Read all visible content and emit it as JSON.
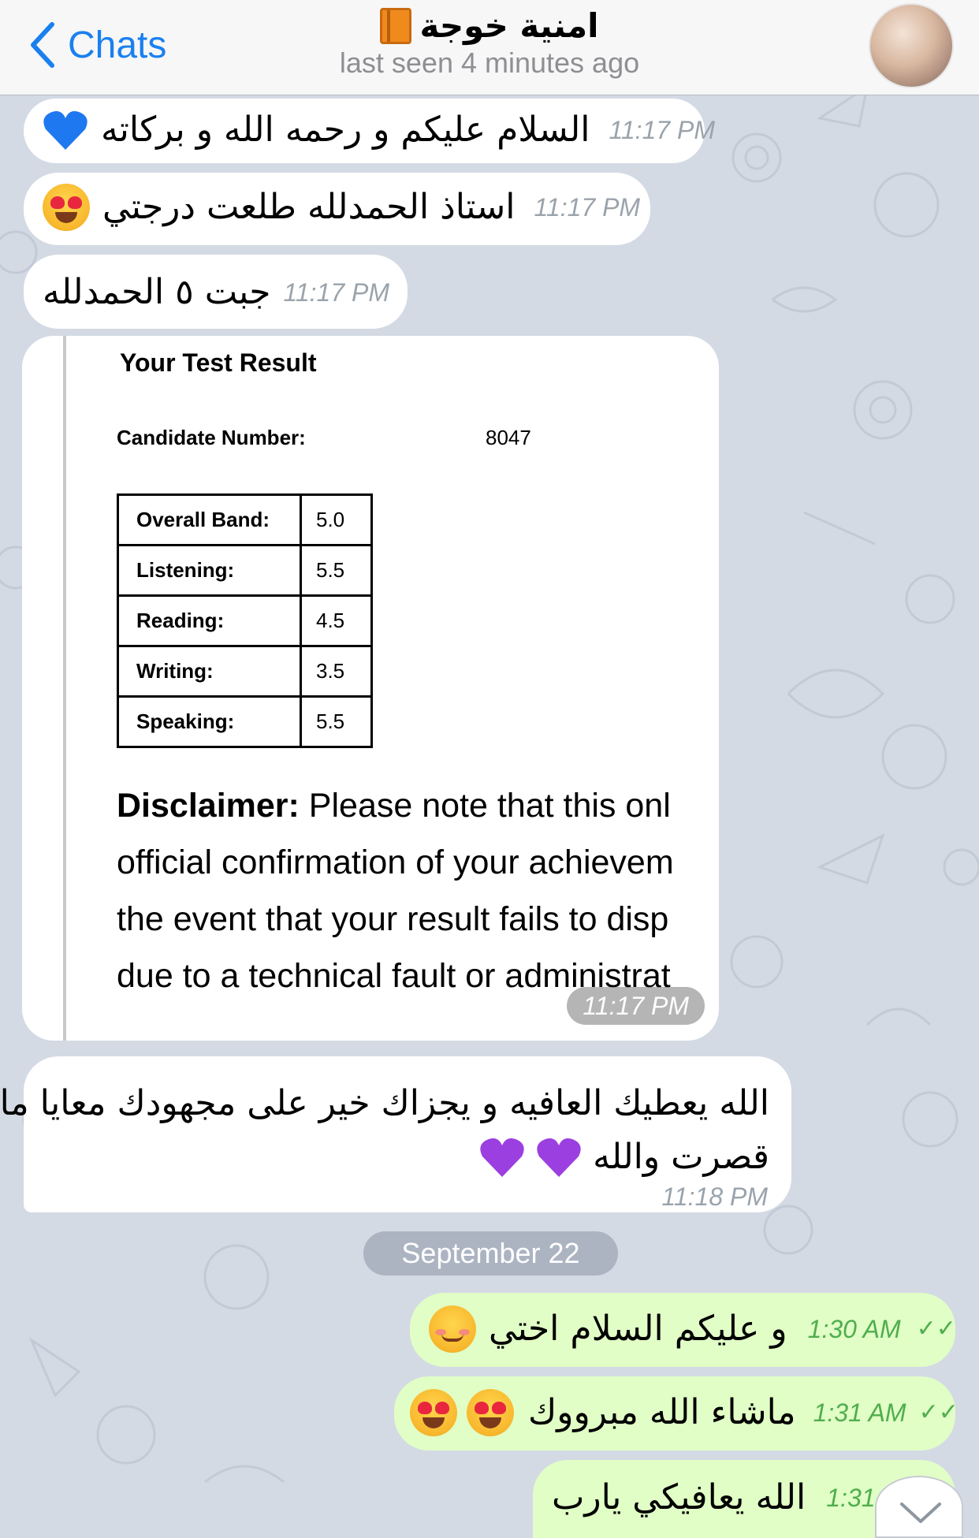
{
  "header": {
    "back_label": "Chats",
    "contact_name": "امنية خوجة",
    "status": "last seen 4 minutes ago"
  },
  "messages": [
    {
      "text": "السلام عليكم و رحمه الله و بركاته",
      "time": "11:17 PM",
      "emoji": [
        "blue-heart"
      ]
    },
    {
      "text": "استاذ الحمدلله طلعت درجتي",
      "time": "11:17 PM",
      "emoji": [
        "heart-eyes"
      ]
    },
    {
      "text": "جبت ٥ الحمدلله",
      "time": "11:17 PM"
    },
    {
      "text_line1": "الله يعطيك العافيه و يجزاك خير على مجهودك معايا ما",
      "text_line2": "قصرت والله",
      "time": "11:18 PM",
      "emoji": [
        "purple-heart",
        "purple-heart"
      ]
    }
  ],
  "photo": {
    "title": "Your Test Result",
    "candidate_label": "Candidate Number:",
    "candidate_number": "8047",
    "bands": [
      {
        "label": "Overall Band:",
        "score": "5.0"
      },
      {
        "label": "Listening:",
        "score": "5.5"
      },
      {
        "label": "Reading:",
        "score": "4.5"
      },
      {
        "label": "Writing:",
        "score": "3.5"
      },
      {
        "label": "Speaking:",
        "score": "5.5"
      }
    ],
    "disclaimer_bold": "Disclaimer:",
    "disclaimer_line1": " Please note that this onl",
    "disclaimer_line2": "official confirmation of your achievem",
    "disclaimer_line3": "the event that your result fails to disp",
    "disclaimer_line4": "due to a technical fault or administrat",
    "time": "11:17 PM"
  },
  "date_separator": "September 22",
  "outgoing": [
    {
      "text": "و عليكم السلام اختي",
      "time": "1:30 AM",
      "emoji": [
        "smiling-face"
      ]
    },
    {
      "text": "ماشاء الله مبرووك",
      "time": "1:31 AM",
      "emoji": [
        "heart-eyes",
        "heart-eyes"
      ]
    },
    {
      "text": "الله يعافيكي يارب",
      "time": "1:31 A"
    }
  ],
  "colors": {
    "accent": "#1a80f0",
    "outgoing_bubble": "#e1fec6",
    "incoming_bubble": "#ffffff",
    "read_check": "#4fae4e"
  }
}
